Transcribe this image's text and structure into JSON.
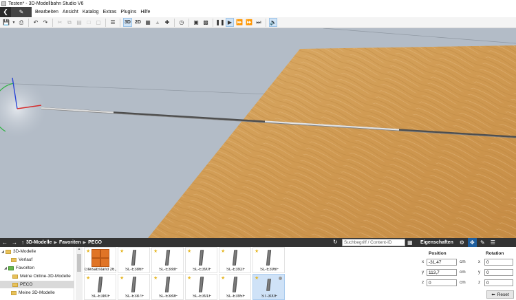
{
  "window": {
    "title": "Testen* - 3D-Modellbahn Studio V6"
  },
  "menubar": {
    "back_icon": "arrow-left-icon",
    "edit_icon": "pen-icon",
    "items": [
      "Bearbeiten",
      "Ansicht",
      "Katalog",
      "Extras",
      "Plugins",
      "Hilfe"
    ]
  },
  "toolbar": {
    "view_3d": "3D",
    "view_2d": "2D"
  },
  "navigator": {
    "breadcrumb": [
      "3D-Modelle",
      "Favoriten",
      "PECO"
    ],
    "search_placeholder": "Suchbegriff / Content-ID"
  },
  "tree": [
    {
      "label": "3D-Modelle",
      "level": 0,
      "icon": "folder",
      "expanded": true
    },
    {
      "label": "Verlauf",
      "level": 1,
      "icon": "folder"
    },
    {
      "label": "Favoriten",
      "level": 1,
      "icon": "folder-green",
      "expanded": true
    },
    {
      "label": "Meine Online-3D-Modelle",
      "level": 2,
      "icon": "folder"
    },
    {
      "label": "PECO",
      "level": 2,
      "icon": "folder",
      "selected": true
    },
    {
      "label": "Meine 3D-Modelle",
      "level": 1,
      "icon": "folder"
    }
  ],
  "catalog": [
    {
      "caption": "Gleisabstand 26,...",
      "kind": "box",
      "star": true
    },
    {
      "caption": "SL-E386F",
      "kind": "rail",
      "star": true
    },
    {
      "caption": "SL-E388F",
      "kind": "rail",
      "star": true
    },
    {
      "caption": "SL-E390F",
      "kind": "rail",
      "star": true
    },
    {
      "caption": "SL-E392F",
      "kind": "rail",
      "star": true
    },
    {
      "caption": "SL-E396F",
      "kind": "rail",
      "star": true
    },
    {
      "caption": "SL-E380F",
      "kind": "rail",
      "star": true
    },
    {
      "caption": "SL-E387F",
      "kind": "rail",
      "star": true
    },
    {
      "caption": "SL-E389F",
      "kind": "rail",
      "star": true
    },
    {
      "caption": "SL-E391F",
      "kind": "rail",
      "star": true
    },
    {
      "caption": "SL-E395F",
      "kind": "rail",
      "star": true
    },
    {
      "caption": "ST-300F",
      "kind": "rail",
      "star": true,
      "selected": true
    }
  ],
  "properties": {
    "title": "Eigenschaften",
    "position_heading": "Position",
    "rotation_heading": "Rotation",
    "position": {
      "x": "-31,47",
      "y": "113,7",
      "z": "0"
    },
    "rotation": {
      "x": "0",
      "y": "0",
      "z": "0"
    },
    "unit": "cm",
    "reset_label": "Reset"
  },
  "colors": {
    "sky": "#b3bcc7",
    "table_wood": "#d6a75f",
    "accent": "#1f5f9f",
    "panel_header": "#333333"
  }
}
